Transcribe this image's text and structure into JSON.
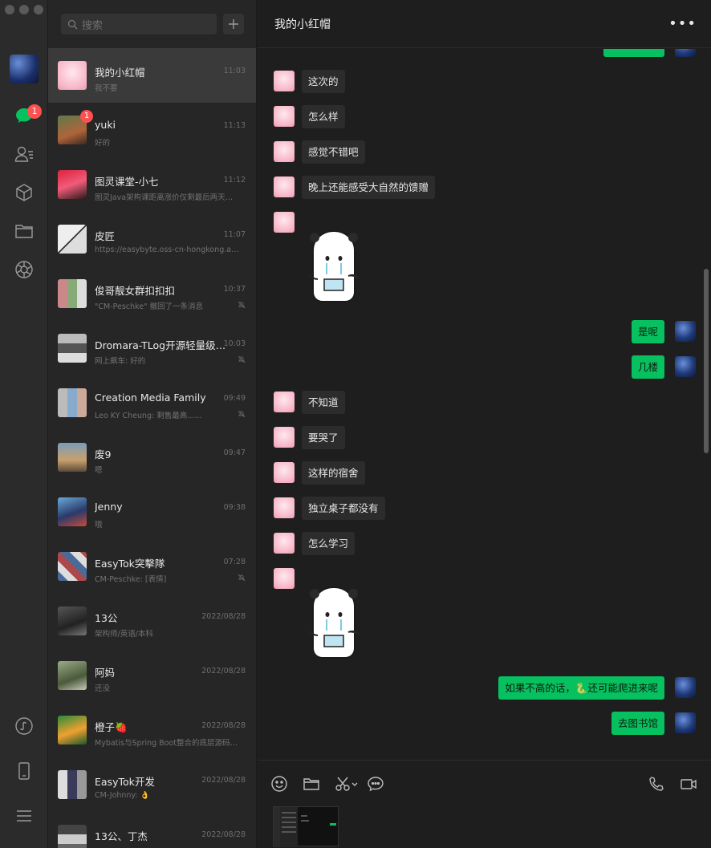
{
  "rail": {
    "badge": "1"
  },
  "search": {
    "placeholder": "搜索"
  },
  "chats": [
    {
      "name": "我的小红帽",
      "time": "11:03",
      "preview": "我不要",
      "active": true
    },
    {
      "name": "yuki",
      "time": "11:13",
      "preview": "好的",
      "badge": "1"
    },
    {
      "name": "图灵课堂-小七",
      "time": "11:12",
      "preview": "图灵Java架构课距离涨价仅剩最后两天！😂"
    },
    {
      "name": "皮匠",
      "time": "11:07",
      "preview": "https://easybyte.oss-cn-hongkong.aliyunc..."
    },
    {
      "name": "俊哥靓女群扣扣扣",
      "time": "10:37",
      "preview": "\"CM-Peschke\" 撤回了一条消息",
      "muted": true
    },
    {
      "name": "Dromara-TLog开源轻量级日...",
      "time": "10:03",
      "preview": "网上飙车: 好的",
      "muted": true
    },
    {
      "name": "Creation Media Family",
      "time": "09:49",
      "preview": "Leo KY Cheung: 剩售最高......",
      "muted": true
    },
    {
      "name": "废9",
      "time": "09:47",
      "preview": "嗯"
    },
    {
      "name": "Jenny",
      "time": "09:38",
      "preview": "哦"
    },
    {
      "name": "EasyTok突擊隊",
      "time": "07:28",
      "preview": "CM-Peschke: [表情]",
      "muted": true
    },
    {
      "name": "13公",
      "time": "2022/08/28",
      "preview": "架构师/英语/本科"
    },
    {
      "name": "阿妈",
      "time": "2022/08/28",
      "preview": "还没"
    },
    {
      "name": "橙子🍓",
      "time": "2022/08/28",
      "preview": "Mybatis与Spring Boot整合的底层源码分析..."
    },
    {
      "name": "EasyTok开发",
      "time": "2022/08/28",
      "preview": "CM-Johnny: 👌"
    },
    {
      "name": "13公、丁杰",
      "time": "2022/08/28",
      "preview": ""
    }
  ],
  "conversation": {
    "title": "我的小红帽",
    "more": "•••",
    "messages": [
      {
        "dir": "in",
        "text": "这次的"
      },
      {
        "dir": "in",
        "text": "怎么样"
      },
      {
        "dir": "in",
        "text": "感觉不错吧"
      },
      {
        "dir": "in",
        "text": "晚上还能感受大自然的馈赠"
      },
      {
        "dir": "in",
        "sticker": "ghost-sticker"
      },
      {
        "dir": "out",
        "text": "是呢"
      },
      {
        "dir": "out",
        "text": "几楼"
      },
      {
        "dir": "in",
        "text": "不知道"
      },
      {
        "dir": "in",
        "text": "要哭了"
      },
      {
        "dir": "in",
        "text": "这样的宿舍"
      },
      {
        "dir": "in",
        "text": "独立桌子都没有"
      },
      {
        "dir": "in",
        "text": "怎么学习"
      },
      {
        "dir": "in",
        "sticker": "ghost-sticker"
      },
      {
        "dir": "out",
        "text": "如果不高的话，🐍还可能爬进来呢"
      },
      {
        "dir": "out",
        "text": "去图书馆"
      }
    ]
  }
}
